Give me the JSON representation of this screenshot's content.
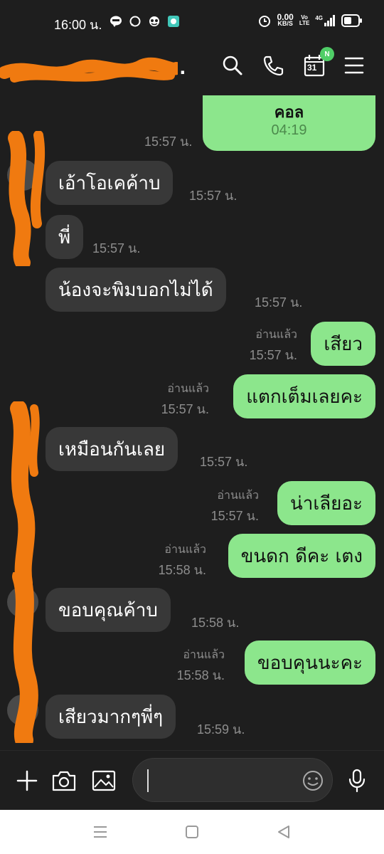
{
  "status_bar": {
    "time": "16:00 น.",
    "net_speed_value": "0.00",
    "net_speed_unit": "KB/S",
    "volte_top": "Vo",
    "volte_bottom": "LTE",
    "network": "4G",
    "app_icons": [
      "line-icon",
      "chat-bubble-icon",
      "app-logo-icon",
      "app-square-icon"
    ]
  },
  "header": {
    "contact_name": "...",
    "calendar_day": "31",
    "calendar_badge": "N"
  },
  "messages": [
    {
      "id": "call",
      "side": "out",
      "type": "call",
      "label": "คอล",
      "duration": "04:19",
      "time": "15:57 น."
    },
    {
      "id": "m1",
      "side": "in",
      "text": "เอ้าโอเคค้าบ",
      "time": "15:57 น."
    },
    {
      "id": "m2",
      "side": "in",
      "text": "พี่",
      "time": "15:57 น."
    },
    {
      "id": "m3",
      "side": "in",
      "text": "น้องจะพิมบอกไม่ได้",
      "time": "15:57 น."
    },
    {
      "id": "m4",
      "side": "out",
      "text": "เสียว",
      "read": "อ่านแล้ว",
      "time": "15:57 น."
    },
    {
      "id": "m5",
      "side": "out",
      "text": "แตกเต็มเลยคะ",
      "read": "อ่านแล้ว",
      "time": "15:57 น."
    },
    {
      "id": "m6",
      "side": "in",
      "text": "เหมือนกันเลย",
      "time": "15:57 น."
    },
    {
      "id": "m7",
      "side": "out",
      "text": "น่าเลียอะ",
      "read": "อ่านแล้ว",
      "time": "15:57 น."
    },
    {
      "id": "m8",
      "side": "out",
      "text": "ขนดก ดีคะ เตง",
      "read": "อ่านแล้ว",
      "time": "15:58 น."
    },
    {
      "id": "m9",
      "side": "in",
      "text": "ขอบคุณค้าบ",
      "time": "15:58 น."
    },
    {
      "id": "m10",
      "side": "out",
      "text": "ขอบคุนนะคะ",
      "read": "อ่านแล้ว",
      "time": "15:58 น."
    },
    {
      "id": "m11",
      "side": "in",
      "text": "เสียวมากๆพี่ๆ",
      "time": "15:59 น."
    }
  ],
  "input": {
    "value": ""
  },
  "colors": {
    "background": "#1e1e1e",
    "incoming_bubble": "#383838",
    "outgoing_bubble": "#8ce68c",
    "timestamp": "#8d8d8d",
    "badge": "#4fce67",
    "redaction": "#f07a10"
  }
}
